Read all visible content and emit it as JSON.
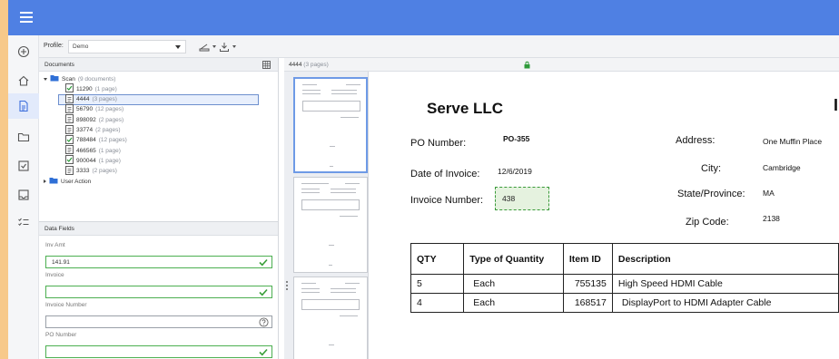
{
  "toolbar": {
    "profile_label": "Profile:",
    "profile_value": "Demo"
  },
  "documents": {
    "header": "Documents",
    "root": {
      "label": "Scan",
      "meta": "(9 documents)"
    },
    "items": [
      {
        "label": "11290",
        "meta": "(1 page)",
        "status": "checked"
      },
      {
        "label": "4444",
        "meta": "(3 pages)",
        "status": "pending",
        "selected": true
      },
      {
        "label": "56790",
        "meta": "(12 pages)",
        "status": "pending"
      },
      {
        "label": "898092",
        "meta": "(2 pages)",
        "status": "pending"
      },
      {
        "label": "33774",
        "meta": "(2 pages)",
        "status": "pending"
      },
      {
        "label": "788484",
        "meta": "(12 pages)",
        "status": "checked"
      },
      {
        "label": "466565",
        "meta": "(1 page)",
        "status": "pending"
      },
      {
        "label": "900044",
        "meta": "(1 page)",
        "status": "checked"
      },
      {
        "label": "3333",
        "meta": "(2 pages)",
        "status": "pending"
      }
    ],
    "second_folder": {
      "label": "User Action"
    }
  },
  "data_fields": {
    "header": "Data Fields",
    "fields": [
      {
        "label": "Inv Amt",
        "value": "141.91",
        "state": "valid"
      },
      {
        "label": "Invoice",
        "value": "",
        "state": "valid"
      },
      {
        "label": "Invoice Number",
        "value": "",
        "state": "help"
      },
      {
        "label": "PO Number",
        "value": "",
        "state": "valid"
      }
    ]
  },
  "viewer": {
    "title": "4444",
    "meta": "(3 pages)"
  },
  "invoice": {
    "company": "Serve LLC",
    "heading_partial": "I",
    "po_number_label": "PO Number:",
    "po_number_value": "PO-355",
    "date_label": "Date of Invoice:",
    "date_value": "12/6/2019",
    "invoice_number_label": "Invoice Number:",
    "invoice_number_value": "438",
    "address_label": "Address:",
    "address_value": "One Muffin Place",
    "city_label": "City:",
    "city_value": "Cambridge",
    "state_label": "State/Province:",
    "state_value": "MA",
    "zip_label": "Zip Code:",
    "zip_value": "2138",
    "table": {
      "headers": [
        "QTY",
        "Type of Quantity",
        "Item ID",
        "Description"
      ],
      "rows": [
        [
          "5",
          "Each",
          "755135",
          "High Speed HDMI Cable"
        ],
        [
          "4",
          "Each",
          "168517",
          "DisplayPort to HDMI Adapter Cable"
        ]
      ]
    }
  },
  "colors": {
    "topbar": "#4f80e3",
    "accent": "#3d6fdc",
    "valid": "#4caf50",
    "frame": "#f7c98a"
  },
  "icons": {
    "rail": [
      "plus-circle-icon",
      "home-icon",
      "document-icon",
      "folder-icon",
      "checkbox-icon",
      "inbox-icon",
      "checklist-icon"
    ]
  }
}
